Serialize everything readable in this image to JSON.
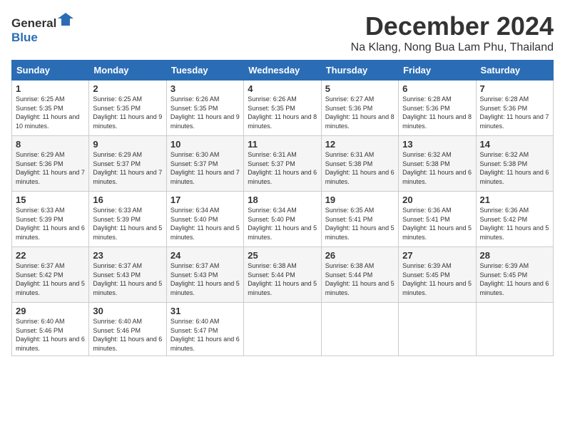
{
  "logo": {
    "general": "General",
    "blue": "Blue"
  },
  "title": "December 2024",
  "location": "Na Klang, Nong Bua Lam Phu, Thailand",
  "days_of_week": [
    "Sunday",
    "Monday",
    "Tuesday",
    "Wednesday",
    "Thursday",
    "Friday",
    "Saturday"
  ],
  "weeks": [
    [
      {
        "day": "1",
        "sunrise": "6:25 AM",
        "sunset": "5:35 PM",
        "daylight": "11 hours and 10 minutes."
      },
      {
        "day": "2",
        "sunrise": "6:25 AM",
        "sunset": "5:35 PM",
        "daylight": "11 hours and 9 minutes."
      },
      {
        "day": "3",
        "sunrise": "6:26 AM",
        "sunset": "5:35 PM",
        "daylight": "11 hours and 9 minutes."
      },
      {
        "day": "4",
        "sunrise": "6:26 AM",
        "sunset": "5:35 PM",
        "daylight": "11 hours and 8 minutes."
      },
      {
        "day": "5",
        "sunrise": "6:27 AM",
        "sunset": "5:36 PM",
        "daylight": "11 hours and 8 minutes."
      },
      {
        "day": "6",
        "sunrise": "6:28 AM",
        "sunset": "5:36 PM",
        "daylight": "11 hours and 8 minutes."
      },
      {
        "day": "7",
        "sunrise": "6:28 AM",
        "sunset": "5:36 PM",
        "daylight": "11 hours and 7 minutes."
      }
    ],
    [
      {
        "day": "8",
        "sunrise": "6:29 AM",
        "sunset": "5:36 PM",
        "daylight": "11 hours and 7 minutes."
      },
      {
        "day": "9",
        "sunrise": "6:29 AM",
        "sunset": "5:37 PM",
        "daylight": "11 hours and 7 minutes."
      },
      {
        "day": "10",
        "sunrise": "6:30 AM",
        "sunset": "5:37 PM",
        "daylight": "11 hours and 7 minutes."
      },
      {
        "day": "11",
        "sunrise": "6:31 AM",
        "sunset": "5:37 PM",
        "daylight": "11 hours and 6 minutes."
      },
      {
        "day": "12",
        "sunrise": "6:31 AM",
        "sunset": "5:38 PM",
        "daylight": "11 hours and 6 minutes."
      },
      {
        "day": "13",
        "sunrise": "6:32 AM",
        "sunset": "5:38 PM",
        "daylight": "11 hours and 6 minutes."
      },
      {
        "day": "14",
        "sunrise": "6:32 AM",
        "sunset": "5:38 PM",
        "daylight": "11 hours and 6 minutes."
      }
    ],
    [
      {
        "day": "15",
        "sunrise": "6:33 AM",
        "sunset": "5:39 PM",
        "daylight": "11 hours and 6 minutes."
      },
      {
        "day": "16",
        "sunrise": "6:33 AM",
        "sunset": "5:39 PM",
        "daylight": "11 hours and 5 minutes."
      },
      {
        "day": "17",
        "sunrise": "6:34 AM",
        "sunset": "5:40 PM",
        "daylight": "11 hours and 5 minutes."
      },
      {
        "day": "18",
        "sunrise": "6:34 AM",
        "sunset": "5:40 PM",
        "daylight": "11 hours and 5 minutes."
      },
      {
        "day": "19",
        "sunrise": "6:35 AM",
        "sunset": "5:41 PM",
        "daylight": "11 hours and 5 minutes."
      },
      {
        "day": "20",
        "sunrise": "6:36 AM",
        "sunset": "5:41 PM",
        "daylight": "11 hours and 5 minutes."
      },
      {
        "day": "21",
        "sunrise": "6:36 AM",
        "sunset": "5:42 PM",
        "daylight": "11 hours and 5 minutes."
      }
    ],
    [
      {
        "day": "22",
        "sunrise": "6:37 AM",
        "sunset": "5:42 PM",
        "daylight": "11 hours and 5 minutes."
      },
      {
        "day": "23",
        "sunrise": "6:37 AM",
        "sunset": "5:43 PM",
        "daylight": "11 hours and 5 minutes."
      },
      {
        "day": "24",
        "sunrise": "6:37 AM",
        "sunset": "5:43 PM",
        "daylight": "11 hours and 5 minutes."
      },
      {
        "day": "25",
        "sunrise": "6:38 AM",
        "sunset": "5:44 PM",
        "daylight": "11 hours and 5 minutes."
      },
      {
        "day": "26",
        "sunrise": "6:38 AM",
        "sunset": "5:44 PM",
        "daylight": "11 hours and 5 minutes."
      },
      {
        "day": "27",
        "sunrise": "6:39 AM",
        "sunset": "5:45 PM",
        "daylight": "11 hours and 5 minutes."
      },
      {
        "day": "28",
        "sunrise": "6:39 AM",
        "sunset": "5:45 PM",
        "daylight": "11 hours and 6 minutes."
      }
    ],
    [
      {
        "day": "29",
        "sunrise": "6:40 AM",
        "sunset": "5:46 PM",
        "daylight": "11 hours and 6 minutes."
      },
      {
        "day": "30",
        "sunrise": "6:40 AM",
        "sunset": "5:46 PM",
        "daylight": "11 hours and 6 minutes."
      },
      {
        "day": "31",
        "sunrise": "6:40 AM",
        "sunset": "5:47 PM",
        "daylight": "11 hours and 6 minutes."
      },
      null,
      null,
      null,
      null
    ]
  ],
  "labels": {
    "sunrise": "Sunrise:",
    "sunset": "Sunset:",
    "daylight": "Daylight:"
  }
}
